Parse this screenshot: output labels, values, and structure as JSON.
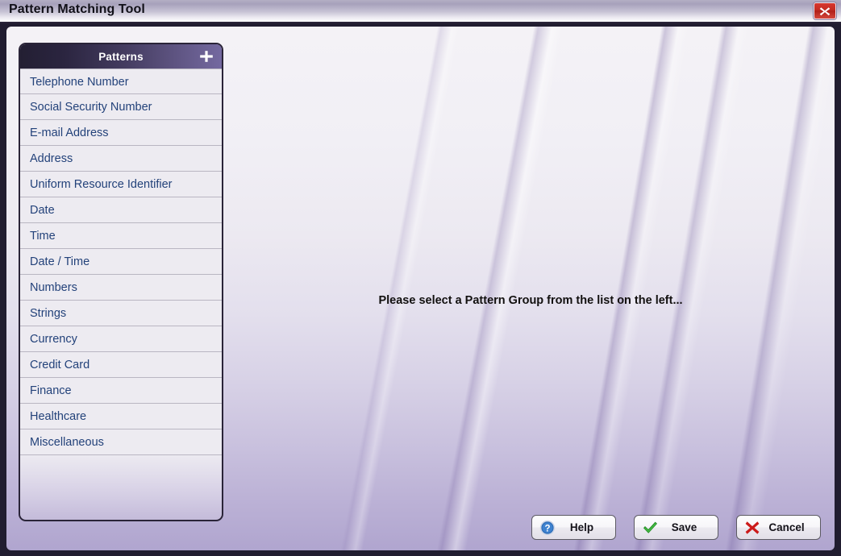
{
  "window": {
    "title": "Pattern Matching Tool",
    "close_icon": "close-icon",
    "accent_dark": "#231f33",
    "accent_purple": "#7469a0",
    "list_text_color": "#23427a",
    "close_button_color": "#c32b22"
  },
  "patterns_panel": {
    "header_title": "Patterns",
    "add_icon": "plus-icon",
    "items": [
      {
        "label": "Telephone Number"
      },
      {
        "label": "Social Security Number"
      },
      {
        "label": "E-mail Address"
      },
      {
        "label": "Address"
      },
      {
        "label": "Uniform Resource Identifier"
      },
      {
        "label": "Date"
      },
      {
        "label": "Time"
      },
      {
        "label": "Date / Time"
      },
      {
        "label": "Numbers"
      },
      {
        "label": "Strings"
      },
      {
        "label": "Currency"
      },
      {
        "label": "Credit Card"
      },
      {
        "label": "Finance"
      },
      {
        "label": "Healthcare"
      },
      {
        "label": "Miscellaneous"
      }
    ]
  },
  "main": {
    "empty_message": "Please select a Pattern Group from the list on the left..."
  },
  "footer": {
    "buttons": [
      {
        "label": "Help",
        "icon": "help-question-icon",
        "icon_color": "#2b6cb8"
      },
      {
        "label": "Save",
        "icon": "check-icon",
        "icon_color": "#2a9a2a"
      },
      {
        "label": "Cancel",
        "icon": "x-mark-icon",
        "icon_color": "#cc1b1b"
      }
    ]
  }
}
